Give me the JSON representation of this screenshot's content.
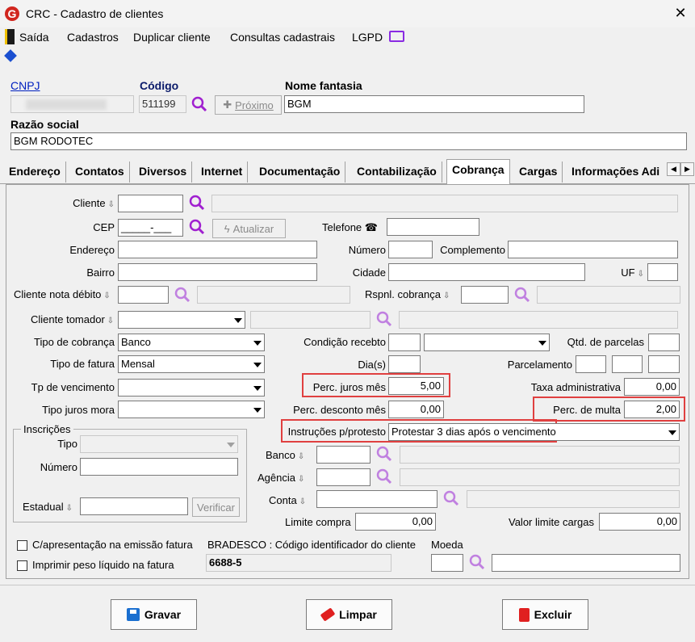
{
  "window": {
    "title": "CRC - Cadastro de clientes",
    "close": "✕"
  },
  "menu": {
    "saida": "Saída",
    "cadastros": "Cadastros",
    "duplicar": "Duplicar cliente",
    "consultas": "Consultas cadastrais",
    "lgpd": "LGPD"
  },
  "header": {
    "cnpj_label": "CNPJ",
    "cnpj_value": "",
    "codigo_label": "Código",
    "codigo_value": "511199",
    "proximo_label": "Próximo",
    "nome_fantasia_label": "Nome fantasia",
    "nome_fantasia_value": "BGM",
    "razao_social_label": "Razão social",
    "razao_social_value": "BGM RODOTEC"
  },
  "tabs": [
    "Endereço",
    "Contatos",
    "Diversos",
    "Internet",
    "Documentação",
    "Contabilização",
    "Cobrança",
    "Cargas",
    "Informações Adi"
  ],
  "active_tab": "Cobrança",
  "form": {
    "cliente": "Cliente",
    "cep": "CEP",
    "cep_value": "_____-___",
    "atualizar": "Atualizar",
    "telefone": "Telefone",
    "endereco": "Endereço",
    "numero": "Número",
    "complemento": "Complemento",
    "bairro": "Bairro",
    "cidade": "Cidade",
    "uf": "UF",
    "cliente_nota_debito": "Cliente nota débito",
    "rspnl_cobranca": "Rspnl. cobrança",
    "cliente_tomador": "Cliente tomador",
    "tipo_cobranca": "Tipo de cobrança",
    "tipo_cobranca_value": "Banco",
    "condicao_recebto": "Condição recebto",
    "qtd_parcelas": "Qtd. de parcelas",
    "tipo_fatura": "Tipo de fatura",
    "tipo_fatura_value": "Mensal",
    "dias": "Dia(s)",
    "parcelamento": "Parcelamento",
    "tp_vencimento": "Tp de vencimento",
    "perc_juros_mes": "Perc. juros mês",
    "perc_juros_mes_value": "5,00",
    "taxa_administrativa": "Taxa administrativa",
    "taxa_administrativa_value": "0,00",
    "tipo_juros_mora": "Tipo juros mora",
    "perc_desconto_mes": "Perc. desconto mês",
    "perc_desconto_mes_value": "0,00",
    "perc_multa": "Perc. de multa",
    "perc_multa_value": "2,00",
    "inscricoes": "Inscrições",
    "tipo": "Tipo",
    "numero_insc": "Número",
    "estadual": "Estadual",
    "verificar": "Verificar",
    "instrucoes_protesto": "Instruções p/protesto",
    "instrucoes_protesto_value": "Protestar 3 dias após o vencimento",
    "banco": "Banco",
    "agencia": "Agência",
    "conta": "Conta",
    "limite_compra": "Limite compra",
    "limite_compra_value": "0,00",
    "valor_limite_cargas": "Valor limite cargas",
    "valor_limite_cargas_value": "0,00",
    "c_apresentacao": "C/apresentação na emissão fatura",
    "imprimir_peso": "Imprimir peso líquido na fatura",
    "bradesco_label": "BRADESCO : Código identificador do cliente",
    "bradesco_value": "6688-5",
    "moeda": "Moeda"
  },
  "buttons": {
    "gravar": "Gravar",
    "limpar": "Limpar",
    "excluir": "Excluir"
  },
  "colors": {
    "highlight": "#e04040",
    "link": "#0020c0",
    "search": "#a020d0"
  }
}
